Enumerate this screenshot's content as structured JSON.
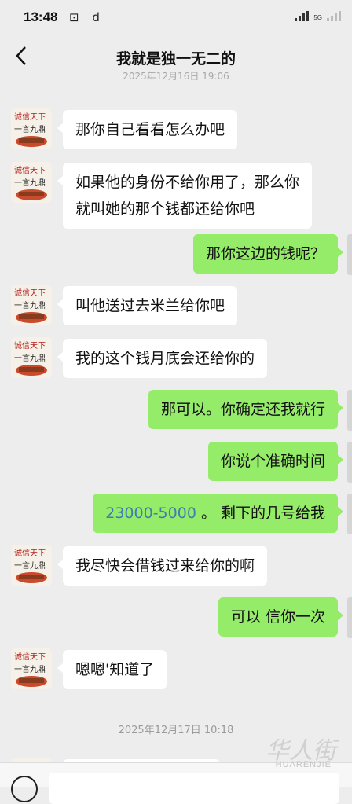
{
  "status_bar": {
    "time": "13:48",
    "left_icons": "⊡ d",
    "network": "5G"
  },
  "header": {
    "title": "我就是独一无二的"
  },
  "timestamp_top": "2025年12月16日 19:06",
  "messages": [
    {
      "side": "in",
      "text": "那你自己看看怎么办吧"
    },
    {
      "side": "in",
      "lines": [
        "如果他的身份不给你用了，那么你",
        "就叫她的那个钱都还给你吧"
      ]
    },
    {
      "side": "out",
      "text": "那你这边的钱呢？"
    },
    {
      "side": "in",
      "text": "叫他送过去米兰给你吧"
    },
    {
      "side": "in",
      "text": "我的这个钱月底会还给你的"
    },
    {
      "side": "out",
      "text": "那可以。你确定还我就行"
    },
    {
      "side": "out",
      "text": "你说个准确时间"
    },
    {
      "side": "out",
      "link": "23000-5000",
      "rest": " 。 剩下的几号给我"
    },
    {
      "side": "in",
      "text": "我尽快会借钱过来给你的啊"
    },
    {
      "side": "out",
      "text": "可以 信你一次"
    },
    {
      "side": "in",
      "text": "嗯嗯'知道了"
    }
  ],
  "timestamp_bottom": "2025年12月17日 10:18",
  "avatar_text": {
    "top": "诚信天下",
    "bottom": "一言九鼎"
  },
  "watermark": {
    "main": "华人街",
    "sub": "HUARENJIE"
  },
  "icons": [
    "back-arrow-icon",
    "voice-icon",
    "signal-icon"
  ],
  "colors": {
    "incoming": "#ffffff",
    "outgoing": "#95ec69",
    "background": "#ededed",
    "link": "#3e7cb1"
  }
}
